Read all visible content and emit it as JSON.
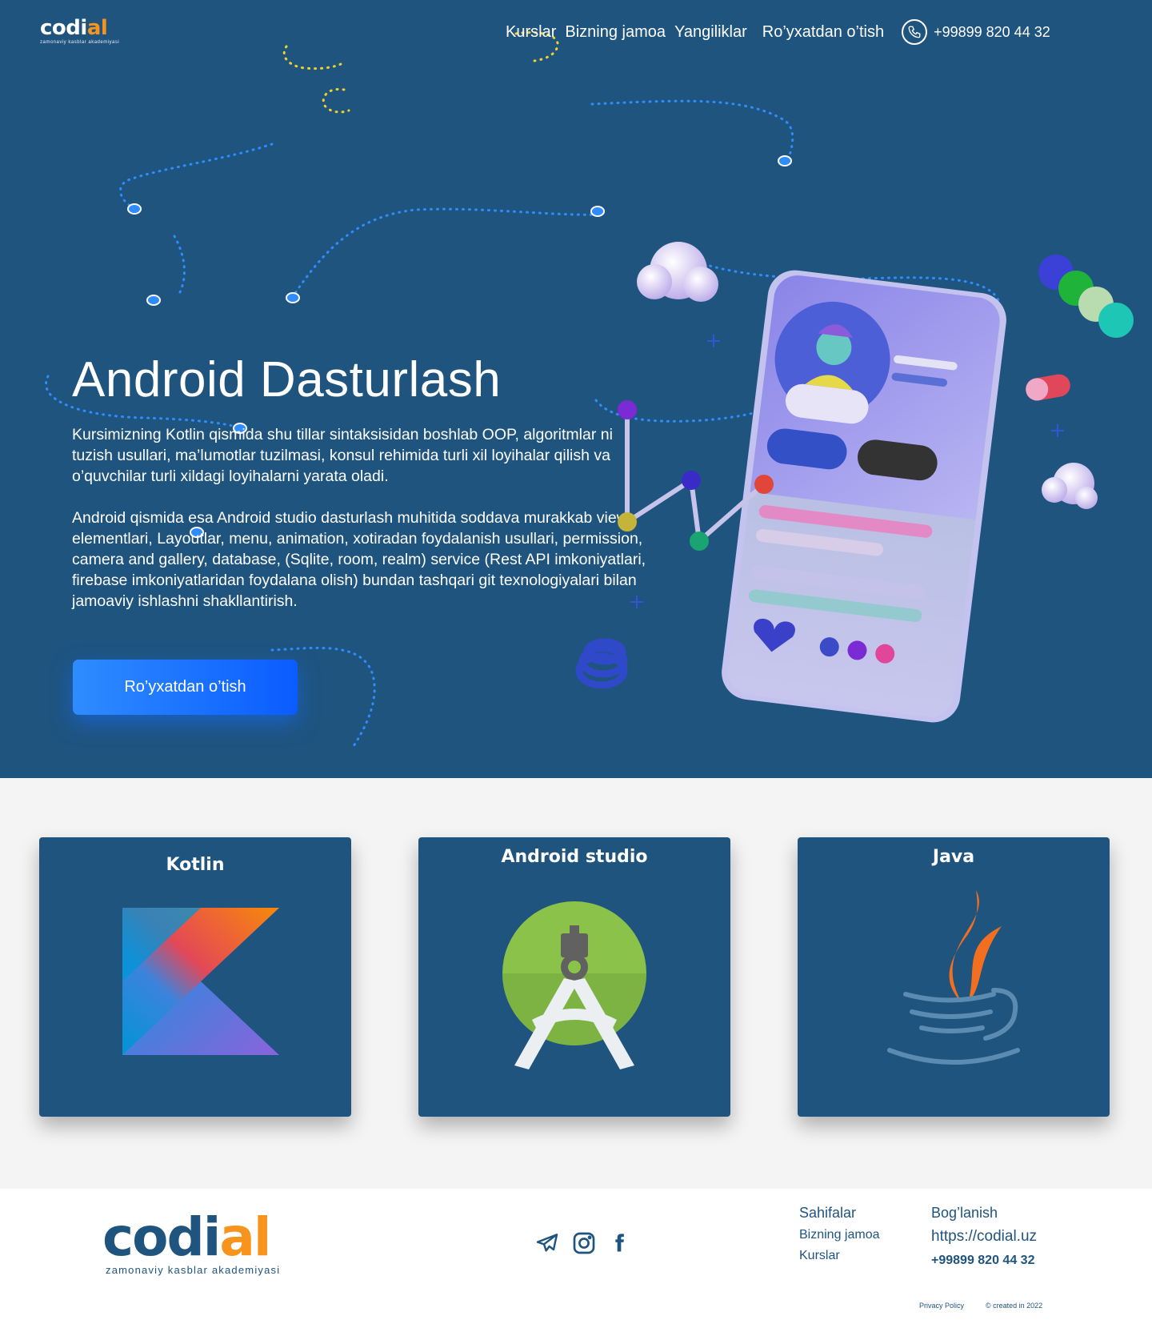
{
  "brand": {
    "name_prefix": "codi",
    "name_accent": "al",
    "tagline": "zamonaviy kasblar akademiyasi"
  },
  "nav": {
    "items": [
      "Kurslar",
      "Bizning jamoa",
      "Yangiliklar",
      "Ro’yxatdan o’tish"
    ],
    "phone": "+99899 820 44 32"
  },
  "hero": {
    "title": "Android Dasturlash",
    "paragraph1": "Kursimizning Kotlin qismida shu tillar sintaksisidan boshlab OOP, algoritmlar ni  tuzish usullari, ma’lumotlar tuzilmasi, konsul rehimida turli xil loyihalar qilish va o’quvchilar turli xildagi loyihalarni yarata oladi.",
    "paragraph2": "Android qismida esa Android studio dasturlash muhitida soddava murakkab view elementlari, Layoutlar, menu, animation, xotiradan foydalanish usullari, permission, camera and  gallery, database, (Sqlite, room, realm) service (Rest API imkoniyatlari, firebase imkoniyatlaridan foydalana olish) bundan tashqari git texnologiyalari bilan jamoaviy ishlashni shakllantirish.",
    "cta_label": "Ro’yxatdan o’tish"
  },
  "cards": [
    {
      "title": "Kotlin",
      "icon": "kotlin-logo-icon"
    },
    {
      "title": "Android studio",
      "icon": "android-studio-logo-icon"
    },
    {
      "title": "Java",
      "icon": "java-logo-icon"
    }
  ],
  "footer": {
    "socials": [
      "telegram-icon",
      "instagram-icon",
      "facebook-icon"
    ],
    "pages_heading": "Sahifalar",
    "pages": [
      "Bizning jamoa",
      "Kurslar"
    ],
    "contact_heading": "Bog’lanish",
    "website": "https://codial.uz",
    "phone": "+99899 820 44 32",
    "privacy": "Privacy Policy",
    "copyright": "© created in 2022"
  },
  "colors": {
    "hero_bg": "#1f547f",
    "accent": "#f7941d",
    "cta": "#1a6dff",
    "page_bg": "#f4f4f4"
  }
}
